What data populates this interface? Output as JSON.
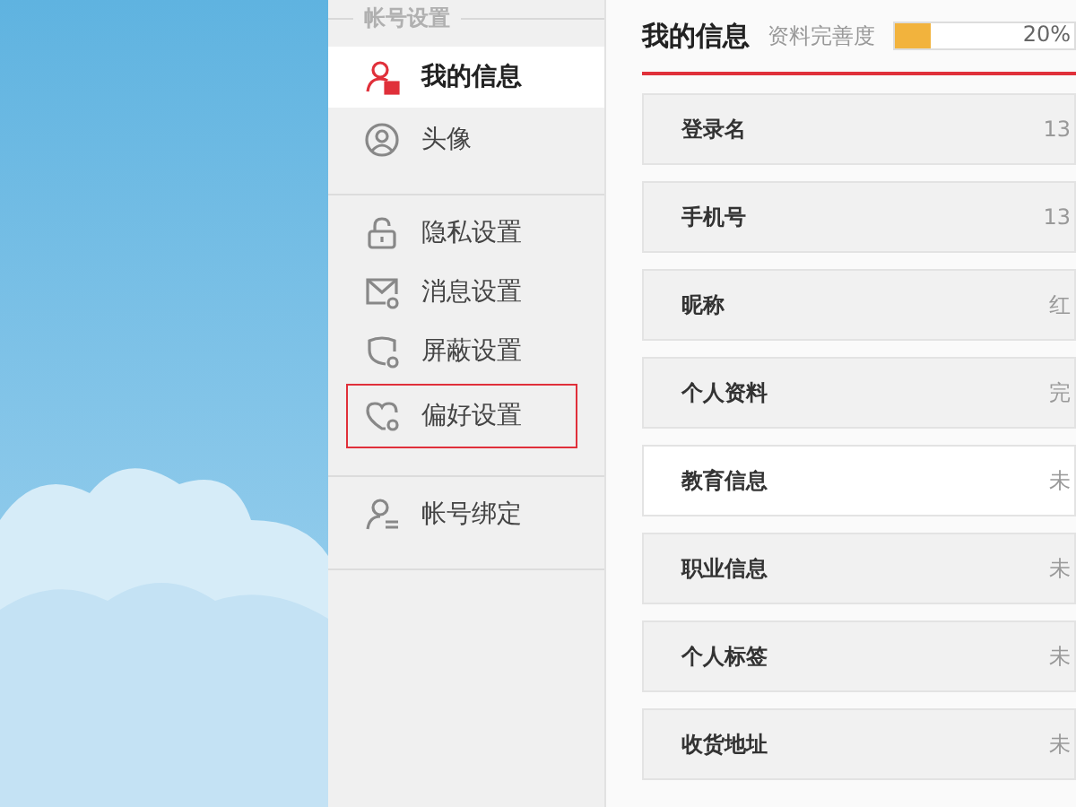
{
  "sidebar": {
    "heading": "帐号设置",
    "groups": [
      [
        {
          "label": "我的信息",
          "kind": "user-card",
          "selected": true,
          "outlined": false
        },
        {
          "label": "头像",
          "kind": "avatar",
          "selected": false,
          "outlined": false
        }
      ],
      [
        {
          "label": "隐私设置",
          "kind": "lock",
          "selected": false,
          "outlined": false
        },
        {
          "label": "消息设置",
          "kind": "mail-gear",
          "selected": false,
          "outlined": false
        },
        {
          "label": "屏蔽设置",
          "kind": "shield-gear",
          "selected": false,
          "outlined": false
        },
        {
          "label": "偏好设置",
          "kind": "heart-gear",
          "selected": false,
          "outlined": true
        }
      ],
      [
        {
          "label": "帐号绑定",
          "kind": "user-link",
          "selected": false,
          "outlined": false
        }
      ]
    ]
  },
  "content": {
    "title": "我的信息",
    "completeness": {
      "label": "资料完善度",
      "level": 0.2,
      "reading": "20%"
    },
    "rows": [
      {
        "label": "登录名",
        "value": "13",
        "hovered": false
      },
      {
        "label": "手机号",
        "value": "13",
        "hovered": false
      },
      {
        "label": "昵称",
        "value": "红",
        "hovered": false
      },
      {
        "label": "个人资料",
        "value": "完",
        "hovered": false
      },
      {
        "label": "教育信息",
        "value": "未",
        "hovered": true
      },
      {
        "label": "职业信息",
        "value": "未",
        "hovered": false
      },
      {
        "label": "个人标签",
        "value": "未",
        "hovered": false
      },
      {
        "label": "收货地址",
        "value": "未",
        "hovered": false
      }
    ]
  }
}
